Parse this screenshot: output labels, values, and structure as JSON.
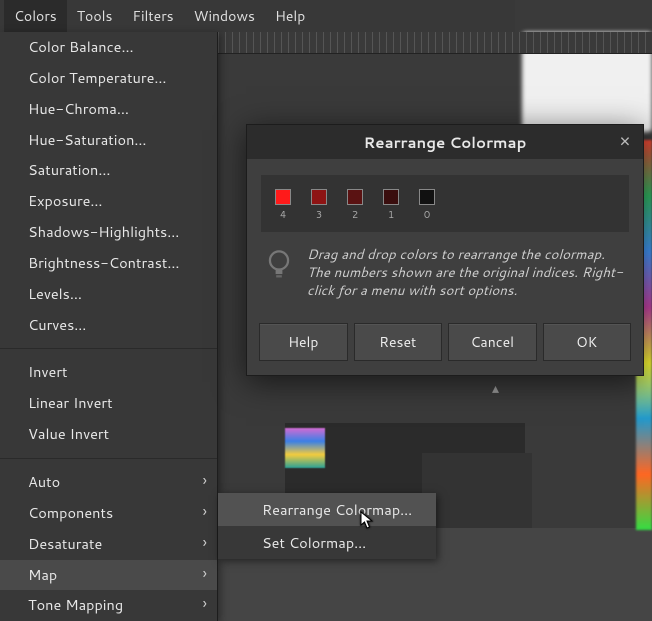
{
  "menubar": {
    "items": [
      "Colors",
      "Tools",
      "Filters",
      "Windows",
      "Help"
    ],
    "active_index": 0
  },
  "colors_menu": {
    "group_adjust": [
      "Color Balance…",
      "Color Temperature…",
      "Hue-Chroma…",
      "Hue-Saturation…",
      "Saturation…",
      "Exposure…",
      "Shadows-Highlights…",
      "Brightness-Contrast…",
      "Levels…",
      "Curves…"
    ],
    "group_invert": [
      "Invert",
      "Linear Invert",
      "Value Invert"
    ],
    "group_submenus": [
      "Auto",
      "Components",
      "Desaturate",
      "Map",
      "Tone Mapping"
    ],
    "hovered": "Map"
  },
  "map_submenu": {
    "items": [
      "Rearrange Colormap…",
      "Set Colormap…"
    ],
    "hovered_index": 0
  },
  "dialog": {
    "title": "Rearrange Colormap",
    "close_label": "×",
    "swatches": [
      {
        "color": "#ff1a1a",
        "index": "4"
      },
      {
        "color": "#8e1414",
        "index": "3"
      },
      {
        "color": "#5a1212",
        "index": "2"
      },
      {
        "color": "#3a0e0e",
        "index": "1"
      },
      {
        "color": "#111111",
        "index": "0"
      }
    ],
    "hint": "Drag and drop colors to rearrange the colormap.  The numbers shown are the original indices.  Right-click for a menu with sort options.",
    "buttons": {
      "help": "Help",
      "reset": "Reset",
      "cancel": "Cancel",
      "ok": "OK"
    }
  }
}
